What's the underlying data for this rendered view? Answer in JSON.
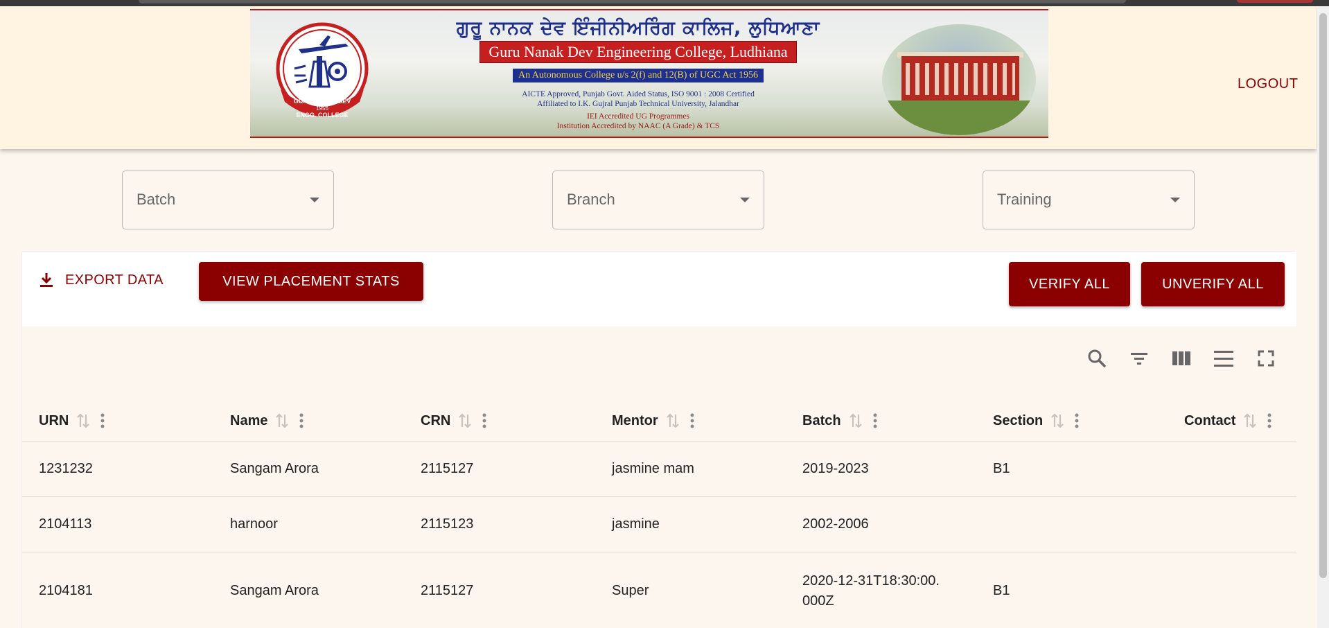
{
  "banner": {
    "punjabi_title": "ਗੁਰੂ ਨਾਨਕ ਦੇਵ ਇੰਜੀਨੀਅਰਿੰਗ ਕਾਲਿਜ, ਲੁਧਿਆਣਾ",
    "english_title": "Guru Nanak Dev Engineering College, Ludhiana",
    "autonomous": "An Autonomous College u/s 2(f) and 12(B) of UGC Act 1956",
    "line1": "AICTE Approved, Punjab Govt. Aided Status, ISO 9001 : 2008 Certified",
    "line2": "Affiliated to I.K. Gujral Punjab Technical University, Jalandhar",
    "line3": "IEI Accredited UG Programmes",
    "line4": "Institution Accredited by NAAC (A Grade) & TCS",
    "logo_top_text": "GURU NANAK DEV",
    "logo_year": "1956",
    "logo_bottom_text": "ENGG. COLLEGE"
  },
  "header": {
    "logout_label": "LOGOUT"
  },
  "filters": {
    "batch_label": "Batch",
    "branch_label": "Branch",
    "training_label": "Training"
  },
  "toolbar": {
    "export_label": "EXPORT DATA",
    "stats_label": "VIEW PLACEMENT STATS",
    "verify_label": "VERIFY ALL",
    "unverify_label": "UNVERIFY ALL"
  },
  "table": {
    "columns": [
      "URN",
      "Name",
      "CRN",
      "Mentor",
      "Batch",
      "Section",
      "Contact"
    ],
    "rows": [
      [
        "1231232",
        "Sangam Arora",
        "2115127",
        "jasmine mam",
        "2019-2023",
        "B1",
        ""
      ],
      [
        "2104113",
        "harnoor",
        "2115123",
        "jasmine",
        "2002-2006",
        "",
        ""
      ],
      [
        "2104181",
        "Sangam Arora",
        "2115127",
        "Super",
        "2020-12-31T18:30:00.000Z",
        "B1",
        ""
      ]
    ]
  },
  "colors": {
    "accent": "#8b0000",
    "header_bg": "#fff4e2",
    "page_bg": "#fdf6ef"
  },
  "icons": [
    "download-icon",
    "search-icon",
    "filter-icon",
    "columns-icon",
    "density-icon",
    "fullscreen-icon",
    "sort-icon",
    "more-vert-icon"
  ]
}
